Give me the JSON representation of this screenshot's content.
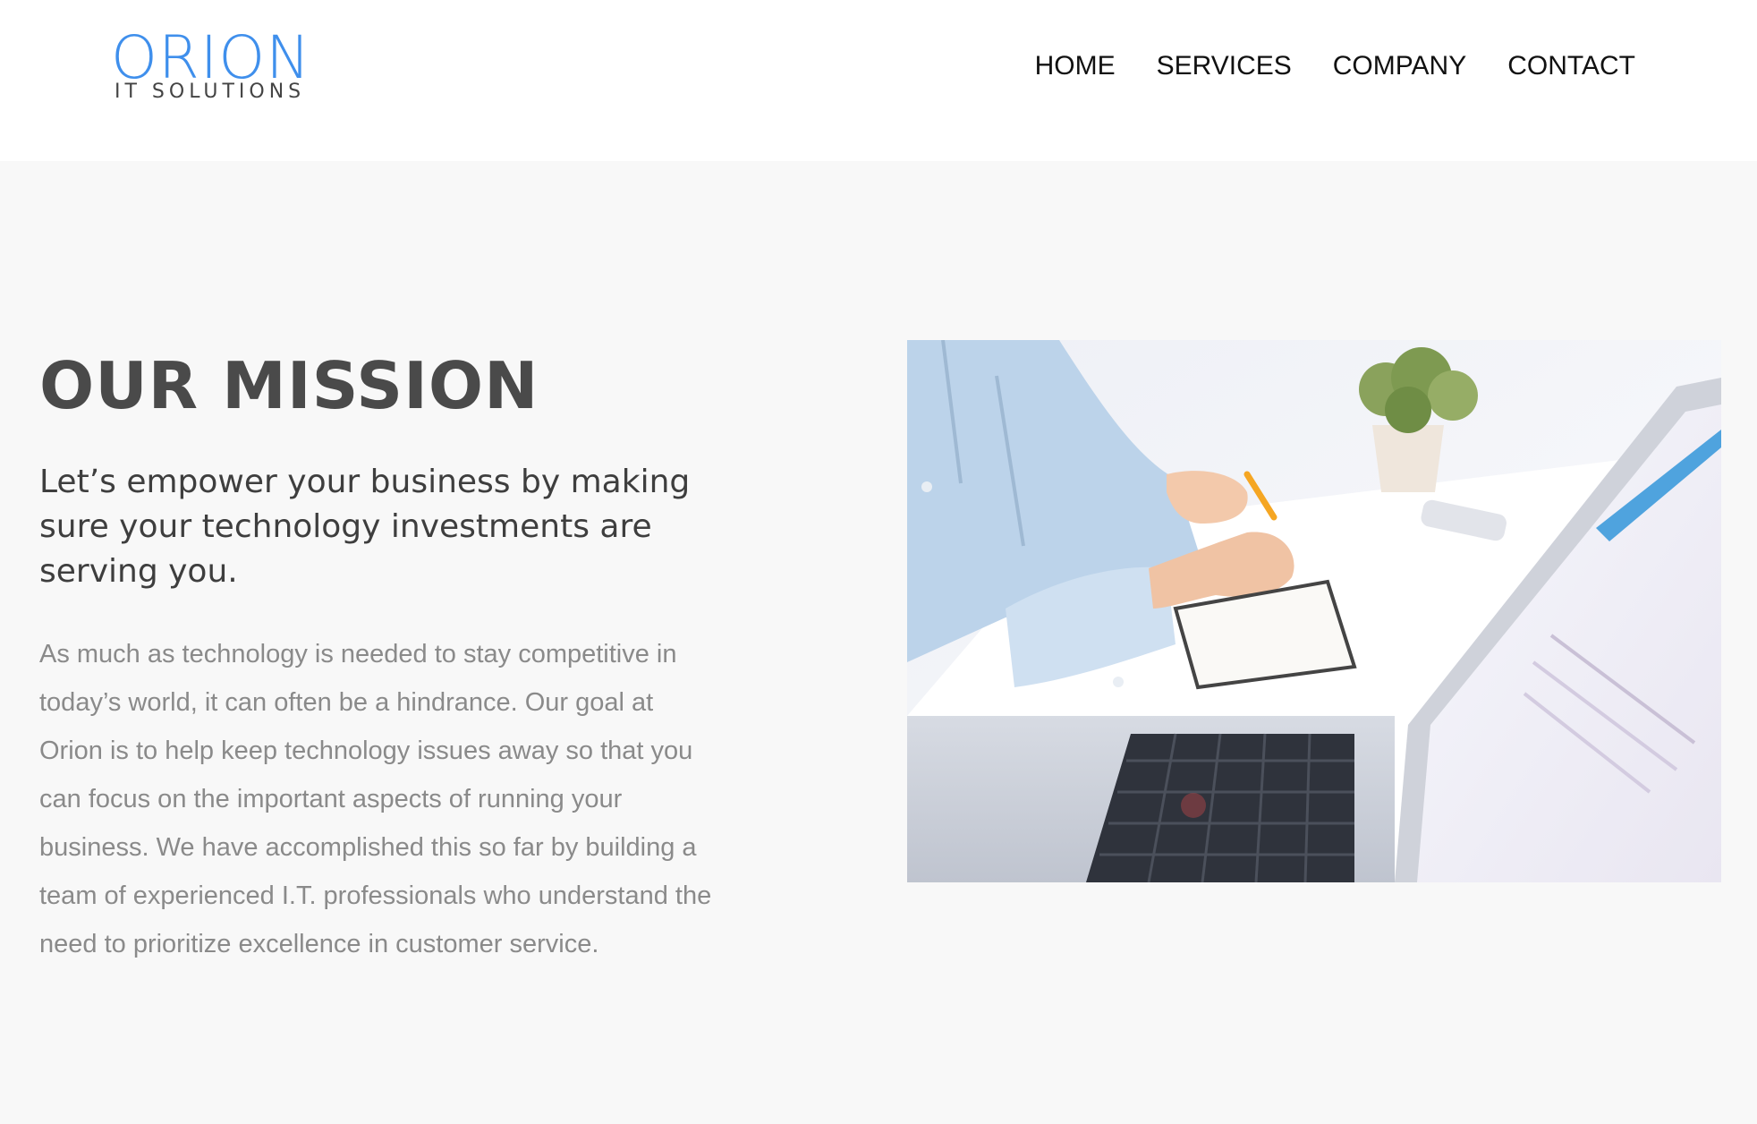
{
  "header": {
    "logo": {
      "wordmark": "ORION",
      "subtitle": "IT SOLUTIONS"
    },
    "nav": [
      {
        "label": "HOME"
      },
      {
        "label": "SERVICES"
      },
      {
        "label": "COMPANY"
      },
      {
        "label": "CONTACT"
      }
    ]
  },
  "mission": {
    "title": "OUR MISSION",
    "lead": "Let’s empower your business by making sure your technology investments are serving you.",
    "body": "As much as technology is needed to stay competitive in today’s world, it can often be a hindrance. Our goal at Orion is to help keep technology issues away so that you can focus on the important aspects of running your business. We have accomplished this so far by building a team of experienced I.T. professionals who understand the need to prioritize excellence in customer service."
  },
  "colors": {
    "brand_blue": "#3f8fec",
    "heading": "#4a4a4a",
    "body_text": "#8a8a8a",
    "section_bg": "#f8f8f8"
  }
}
